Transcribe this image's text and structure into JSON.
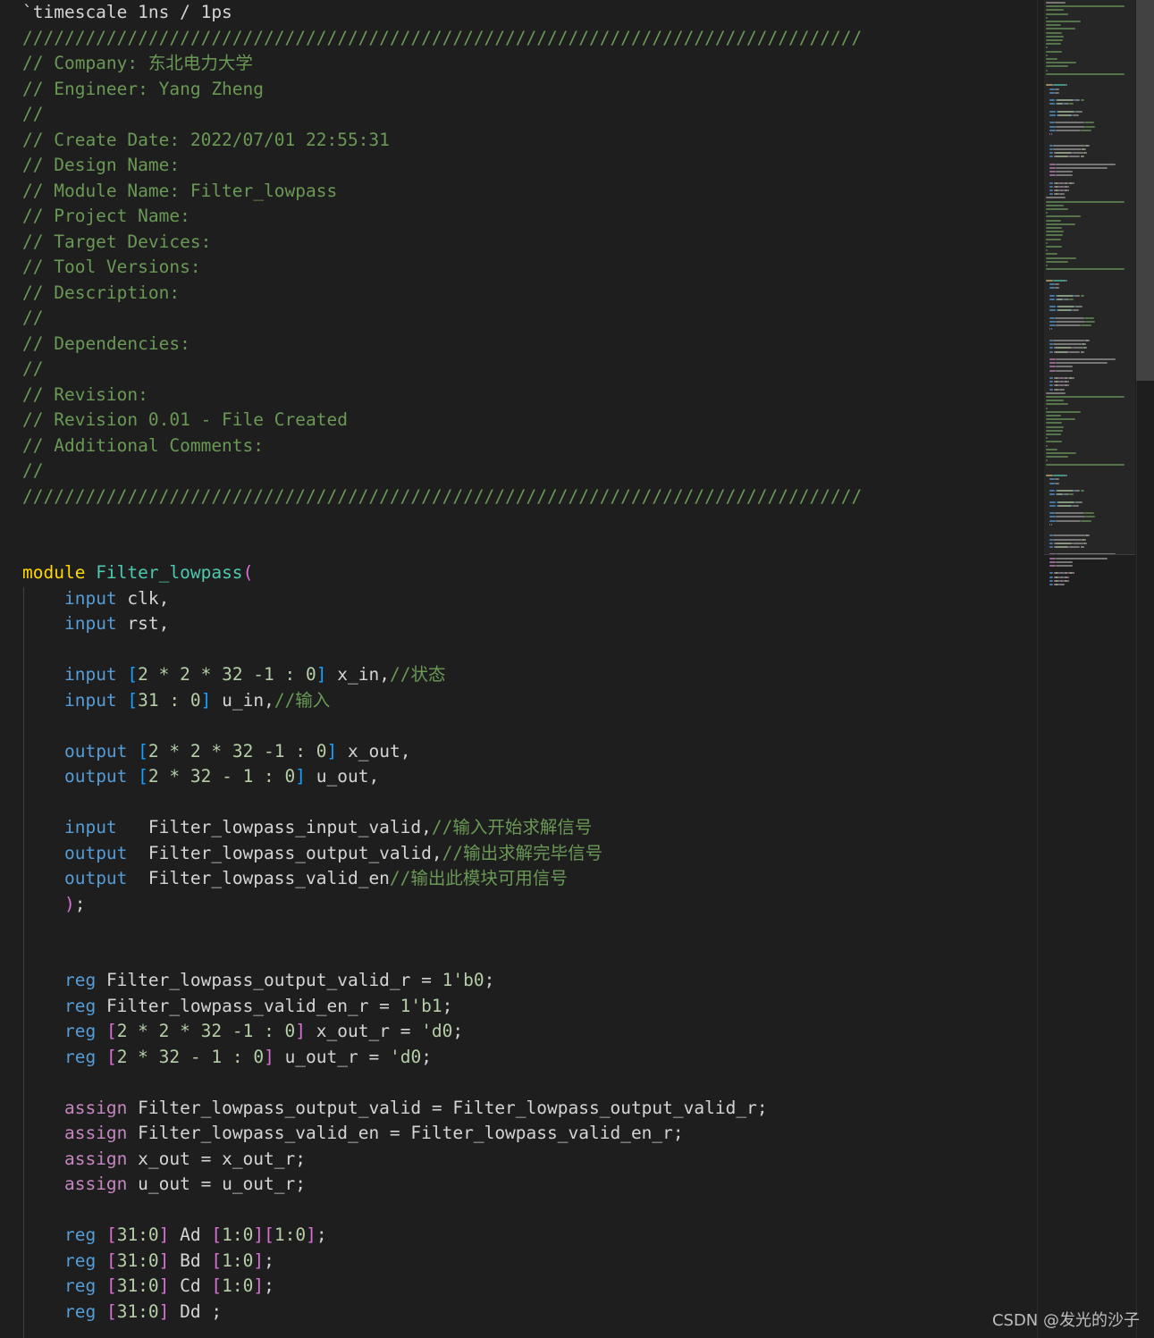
{
  "editor": {
    "lines": [
      [
        {
          "t": "`timescale 1ns / 1ps",
          "c": "txt"
        }
      ],
      [
        {
          "t": "////////////////////////////////////////////////////////////////////////////////",
          "c": "cm"
        }
      ],
      [
        {
          "t": "// Company: 东北电力大学",
          "c": "cm"
        }
      ],
      [
        {
          "t": "// Engineer: Yang Zheng",
          "c": "cm"
        }
      ],
      [
        {
          "t": "//",
          "c": "cm"
        }
      ],
      [
        {
          "t": "// Create Date: 2022/07/01 22:55:31",
          "c": "cm"
        }
      ],
      [
        {
          "t": "// Design Name:",
          "c": "cm"
        }
      ],
      [
        {
          "t": "// Module Name: Filter_lowpass",
          "c": "cm"
        }
      ],
      [
        {
          "t": "// Project Name:",
          "c": "cm"
        }
      ],
      [
        {
          "t": "// Target Devices:",
          "c": "cm"
        }
      ],
      [
        {
          "t": "// Tool Versions:",
          "c": "cm"
        }
      ],
      [
        {
          "t": "// Description:",
          "c": "cm"
        }
      ],
      [
        {
          "t": "//",
          "c": "cm"
        }
      ],
      [
        {
          "t": "// Dependencies:",
          "c": "cm"
        }
      ],
      [
        {
          "t": "//",
          "c": "cm"
        }
      ],
      [
        {
          "t": "// Revision:",
          "c": "cm"
        }
      ],
      [
        {
          "t": "// Revision 0.01 - File Created",
          "c": "cm"
        }
      ],
      [
        {
          "t": "// Additional Comments:",
          "c": "cm"
        }
      ],
      [
        {
          "t": "//",
          "c": "cm"
        }
      ],
      [
        {
          "t": "////////////////////////////////////////////////////////////////////////////////",
          "c": "cm"
        }
      ],
      [],
      [],
      [
        {
          "t": "module ",
          "c": "kw-y"
        },
        {
          "t": "Filter_lowpass",
          "c": "ty"
        },
        {
          "t": "(",
          "c": "brk2"
        }
      ],
      [
        {
          "t": "    "
        },
        {
          "t": "input",
          "c": "kw"
        },
        {
          "t": " clk,",
          "c": "txt"
        }
      ],
      [
        {
          "t": "    "
        },
        {
          "t": "input",
          "c": "kw"
        },
        {
          "t": " rst,",
          "c": "txt"
        }
      ],
      [],
      [
        {
          "t": "    "
        },
        {
          "t": "input",
          "c": "kw"
        },
        {
          "t": " "
        },
        {
          "t": "[",
          "c": "brk"
        },
        {
          "t": "2 * 2 * 32 -1 : 0",
          "c": "num"
        },
        {
          "t": "]",
          "c": "brk"
        },
        {
          "t": " x_in,",
          "c": "txt"
        },
        {
          "t": "//状态",
          "c": "cm"
        }
      ],
      [
        {
          "t": "    "
        },
        {
          "t": "input",
          "c": "kw"
        },
        {
          "t": " "
        },
        {
          "t": "[",
          "c": "brk"
        },
        {
          "t": "31 : 0",
          "c": "num"
        },
        {
          "t": "]",
          "c": "brk"
        },
        {
          "t": " u_in,",
          "c": "txt"
        },
        {
          "t": "//输入",
          "c": "cm"
        }
      ],
      [],
      [
        {
          "t": "    "
        },
        {
          "t": "output",
          "c": "kw"
        },
        {
          "t": " "
        },
        {
          "t": "[",
          "c": "brk"
        },
        {
          "t": "2 * 2 * 32 -1 : 0",
          "c": "num"
        },
        {
          "t": "]",
          "c": "brk"
        },
        {
          "t": " x_out,",
          "c": "txt"
        }
      ],
      [
        {
          "t": "    "
        },
        {
          "t": "output",
          "c": "kw"
        },
        {
          "t": " "
        },
        {
          "t": "[",
          "c": "brk"
        },
        {
          "t": "2 * 32 - 1 : 0",
          "c": "num"
        },
        {
          "t": "]",
          "c": "brk"
        },
        {
          "t": " u_out,",
          "c": "txt"
        }
      ],
      [],
      [
        {
          "t": "    "
        },
        {
          "t": "input",
          "c": "kw"
        },
        {
          "t": "   Filter_lowpass_input_valid,",
          "c": "txt"
        },
        {
          "t": "//输入开始求解信号",
          "c": "cm"
        }
      ],
      [
        {
          "t": "    "
        },
        {
          "t": "output",
          "c": "kw"
        },
        {
          "t": "  Filter_lowpass_output_valid,",
          "c": "txt"
        },
        {
          "t": "//输出求解完毕信号",
          "c": "cm"
        }
      ],
      [
        {
          "t": "    "
        },
        {
          "t": "output",
          "c": "kw"
        },
        {
          "t": "  Filter_lowpass_valid_en",
          "c": "txt"
        },
        {
          "t": "//输出此模块可用信号",
          "c": "cm"
        }
      ],
      [
        {
          "t": "    "
        },
        {
          "t": ")",
          "c": "brk2"
        },
        {
          "t": ";",
          "c": "txt"
        }
      ],
      [],
      [],
      [
        {
          "t": "    "
        },
        {
          "t": "reg",
          "c": "kw"
        },
        {
          "t": " Filter_lowpass_output_valid_r = ",
          "c": "txt"
        },
        {
          "t": "1'b0",
          "c": "num"
        },
        {
          "t": ";",
          "c": "txt"
        }
      ],
      [
        {
          "t": "    "
        },
        {
          "t": "reg",
          "c": "kw"
        },
        {
          "t": " Filter_lowpass_valid_en_r = ",
          "c": "txt"
        },
        {
          "t": "1'b1",
          "c": "num"
        },
        {
          "t": ";",
          "c": "txt"
        }
      ],
      [
        {
          "t": "    "
        },
        {
          "t": "reg",
          "c": "kw"
        },
        {
          "t": " "
        },
        {
          "t": "[",
          "c": "brk2"
        },
        {
          "t": "2 * 2 * 32 -1 : 0",
          "c": "num"
        },
        {
          "t": "]",
          "c": "brk2"
        },
        {
          "t": " x_out_r = ",
          "c": "txt"
        },
        {
          "t": "'d0",
          "c": "num"
        },
        {
          "t": ";",
          "c": "txt"
        }
      ],
      [
        {
          "t": "    "
        },
        {
          "t": "reg",
          "c": "kw"
        },
        {
          "t": " "
        },
        {
          "t": "[",
          "c": "brk2"
        },
        {
          "t": "2 * 32 - 1 : 0",
          "c": "num"
        },
        {
          "t": "]",
          "c": "brk2"
        },
        {
          "t": " u_out_r = ",
          "c": "txt"
        },
        {
          "t": "'d0",
          "c": "num"
        },
        {
          "t": ";",
          "c": "txt"
        }
      ],
      [],
      [
        {
          "t": "    "
        },
        {
          "t": "assign",
          "c": "kw-p"
        },
        {
          "t": " Filter_lowpass_output_valid = Filter_lowpass_output_valid_r;",
          "c": "txt"
        }
      ],
      [
        {
          "t": "    "
        },
        {
          "t": "assign",
          "c": "kw-p"
        },
        {
          "t": " Filter_lowpass_valid_en = Filter_lowpass_valid_en_r;",
          "c": "txt"
        }
      ],
      [
        {
          "t": "    "
        },
        {
          "t": "assign",
          "c": "kw-p"
        },
        {
          "t": " x_out = x_out_r;",
          "c": "txt"
        }
      ],
      [
        {
          "t": "    "
        },
        {
          "t": "assign",
          "c": "kw-p"
        },
        {
          "t": " u_out = u_out_r;",
          "c": "txt"
        }
      ],
      [],
      [
        {
          "t": "    "
        },
        {
          "t": "reg",
          "c": "kw"
        },
        {
          "t": " "
        },
        {
          "t": "[",
          "c": "brk2"
        },
        {
          "t": "31:0",
          "c": "num"
        },
        {
          "t": "]",
          "c": "brk2"
        },
        {
          "t": " Ad ",
          "c": "txt"
        },
        {
          "t": "[",
          "c": "brk2"
        },
        {
          "t": "1:0",
          "c": "num"
        },
        {
          "t": "][",
          "c": "brk2"
        },
        {
          "t": "1:0",
          "c": "num"
        },
        {
          "t": "]",
          "c": "brk2"
        },
        {
          "t": ";",
          "c": "txt"
        }
      ],
      [
        {
          "t": "    "
        },
        {
          "t": "reg",
          "c": "kw"
        },
        {
          "t": " "
        },
        {
          "t": "[",
          "c": "brk2"
        },
        {
          "t": "31:0",
          "c": "num"
        },
        {
          "t": "]",
          "c": "brk2"
        },
        {
          "t": " Bd ",
          "c": "txt"
        },
        {
          "t": "[",
          "c": "brk2"
        },
        {
          "t": "1:0",
          "c": "num"
        },
        {
          "t": "]",
          "c": "brk2"
        },
        {
          "t": ";",
          "c": "txt"
        }
      ],
      [
        {
          "t": "    "
        },
        {
          "t": "reg",
          "c": "kw"
        },
        {
          "t": " "
        },
        {
          "t": "[",
          "c": "brk2"
        },
        {
          "t": "31:0",
          "c": "num"
        },
        {
          "t": "]",
          "c": "brk2"
        },
        {
          "t": " Cd ",
          "c": "txt"
        },
        {
          "t": "[",
          "c": "brk2"
        },
        {
          "t": "1:0",
          "c": "num"
        },
        {
          "t": "]",
          "c": "brk2"
        },
        {
          "t": ";",
          "c": "txt"
        }
      ],
      [
        {
          "t": "    "
        },
        {
          "t": "reg",
          "c": "kw"
        },
        {
          "t": " "
        },
        {
          "t": "[",
          "c": "brk2"
        },
        {
          "t": "31:0",
          "c": "num"
        },
        {
          "t": "]",
          "c": "brk2"
        },
        {
          "t": " Dd ;",
          "c": "txt"
        }
      ]
    ]
  },
  "watermark": "CSDN @发光的沙子",
  "colors": {
    "background": "#1e1e1e",
    "comment": "#6a9955",
    "keyword": "#569cd6",
    "module_keyword": "#ffd700",
    "assign_keyword": "#c586c0",
    "type_name": "#4ec9b0",
    "number": "#b5cea8"
  }
}
